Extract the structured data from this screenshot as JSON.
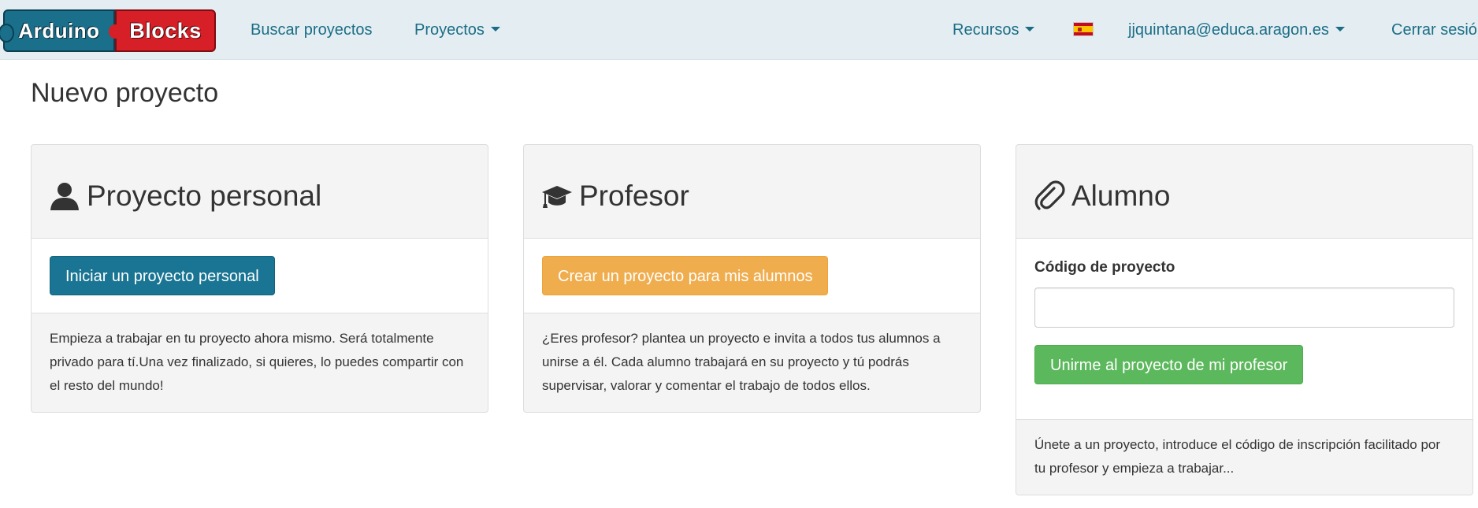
{
  "navbar": {
    "logo": {
      "left_text": "Arduino",
      "right_text": "Blocks"
    },
    "links": {
      "buscar": "Buscar proyectos",
      "proyectos": "Proyectos",
      "recursos": "Recursos",
      "user": "jjquintana@educa.aragon.es",
      "cerrar": "Cerrar sesión"
    },
    "language_flag": "es-flag-icon"
  },
  "page": {
    "title": "Nuevo proyecto"
  },
  "panels": {
    "personal": {
      "title": "Proyecto personal",
      "icon": "user-icon",
      "button_label": "Iniciar un proyecto personal",
      "description": "Empieza a trabajar en tu proyecto ahora mismo. Será totalmente privado para tí.Una vez finalizado, si quieres, lo puedes compartir con el resto del mundo!"
    },
    "profesor": {
      "title": "Profesor",
      "icon": "graduation-cap-icon",
      "button_label": "Crear un proyecto para mis alumnos",
      "description": "¿Eres profesor? plantea un proyecto e invita a todos tus alumnos a unirse a él. Cada alumno trabajará en su proyecto y tú podrás supervisar, valorar y comentar el trabajo de todos ellos."
    },
    "alumno": {
      "title": "Alumno",
      "icon": "paperclip-icon",
      "code_label": "Código de proyecto",
      "code_value": "",
      "button_label": "Unirme al proyecto de mi profesor",
      "description": "Únete a un proyecto, introduce el código de inscripción facilitado por tu profesor y empieza a trabajar..."
    }
  },
  "colors": {
    "navbar_bg": "#e4eef2",
    "link": "#1b6d86",
    "primary": "#197593",
    "warning": "#f0ad4e",
    "success": "#5cb85c"
  }
}
